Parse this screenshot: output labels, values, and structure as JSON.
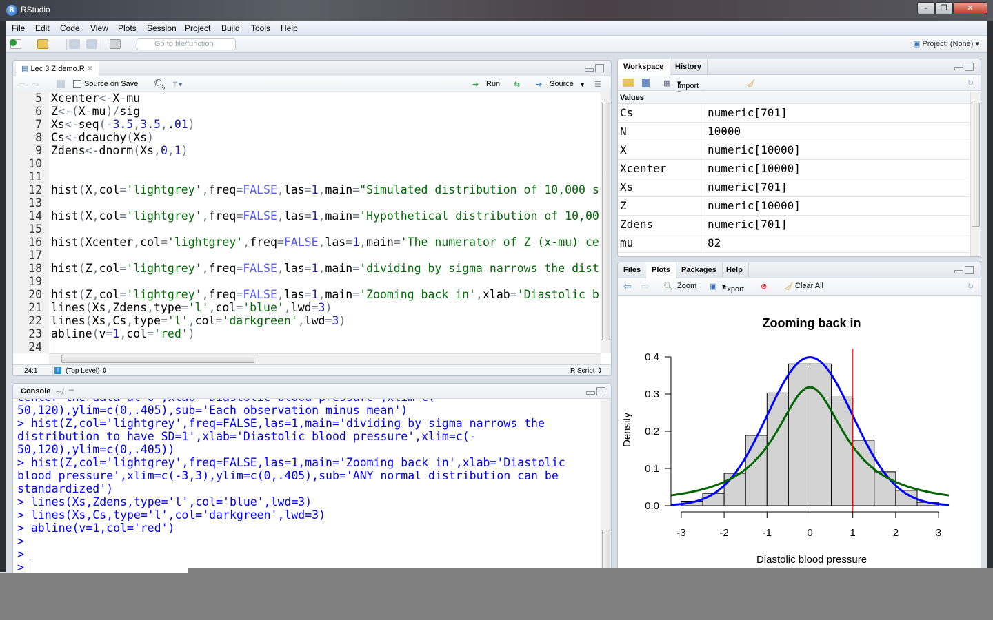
{
  "window": {
    "title": "RStudio"
  },
  "menu": [
    "File",
    "Edit",
    "Code",
    "View",
    "Plots",
    "Session",
    "Project",
    "Build",
    "Tools",
    "Help"
  ],
  "toolbar": {
    "goto_placeholder": "Go to file/function",
    "project": "Project: (None)"
  },
  "editor": {
    "tab": "Lec 3 Z demo.R",
    "source_on_save": "Source on Save",
    "run": "Run",
    "source": "Source",
    "first_line_number": 5,
    "lines": [
      "Xcenter<-X-mu",
      "Z<-(X-mu)/sig",
      "Xs<-seq(-3.5,3.5,.01)",
      "Cs<-dcauchy(Xs)",
      "Zdens<-dnorm(Xs,0,1)",
      "",
      "",
      "hist(X,col='lightgrey',freq=FALSE,las=1,main=\"Simulated distribution of 10,000 s",
      "",
      "hist(X,col='lightgrey',freq=FALSE,las=1,main='Hypothetical distribution of 10,00",
      "",
      "hist(Xcenter,col='lightgrey',freq=FALSE,las=1,main='The numerator of Z (x-mu) ce",
      "",
      "hist(Z,col='lightgrey',freq=FALSE,las=1,main='dividing by sigma narrows the dist",
      "",
      "hist(Z,col='lightgrey',freq=FALSE,las=1,main='Zooming back in',xlab='Diastolic b",
      "lines(Xs,Zdens,type='l',col='blue',lwd=3)",
      "lines(Xs,Cs,type='l',col='darkgreen',lwd=3)",
      "abline(v=1,col='red')",
      ""
    ],
    "cursor_pos": "24:1",
    "scope": "(Top Level)",
    "file_type": "R Script"
  },
  "console": {
    "title": "Console",
    "path": "~/",
    "lines": [
      "center the data at 0',xlab='Diastolic blood pressure',xlim=c(",
      "50,120),ylim=c(0,.405),sub='Each observation minus mean')",
      "> hist(Z,col='lightgrey',freq=FALSE,las=1,main='dividing by sigma narrows the",
      "distribution to have SD=1',xlab='Diastolic blood pressure',xlim=c(-",
      "50,120),ylim=c(0,.405))",
      "> hist(Z,col='lightgrey',freq=FALSE,las=1,main='Zooming back in',xlab='Diastolic",
      "blood pressure',xlim=c(-3,3),ylim=c(0,.405),sub='ANY normal distribution can be",
      "standardized')",
      "> lines(Xs,Zdens,type='l',col='blue',lwd=3)",
      "> lines(Xs,Cs,type='l',col='darkgreen',lwd=3)",
      "> abline(v=1,col='red')",
      ">",
      ">",
      ">"
    ]
  },
  "workspace": {
    "tabs": [
      "Workspace",
      "History"
    ],
    "import": "Import Dataset",
    "section": "Values",
    "rows": [
      {
        "name": "Cs",
        "value": "numeric[701]"
      },
      {
        "name": "N",
        "value": "10000"
      },
      {
        "name": "X",
        "value": "numeric[10000]"
      },
      {
        "name": "Xcenter",
        "value": "numeric[10000]"
      },
      {
        "name": "Xs",
        "value": "numeric[701]"
      },
      {
        "name": "Z",
        "value": "numeric[10000]"
      },
      {
        "name": "Zdens",
        "value": "numeric[701]"
      },
      {
        "name": "mu",
        "value": "82"
      }
    ]
  },
  "plots": {
    "tabs": [
      "Files",
      "Plots",
      "Packages",
      "Help"
    ],
    "zoom": "Zoom",
    "export": "Export",
    "clear_all": "Clear All"
  },
  "chart_data": {
    "type": "bar",
    "title": "Zooming back in",
    "xlabel": "Diastolic blood pressure",
    "ylabel": "Density",
    "subtitle": "ANY normal distribution can be standardized",
    "xlim": [
      -3,
      3
    ],
    "ylim": [
      0,
      0.405
    ],
    "xticks": [
      "-3",
      "-2",
      "-1",
      "0",
      "1",
      "2",
      "3"
    ],
    "yticks": [
      "0.0",
      "0.1",
      "0.2",
      "0.3",
      "0.4"
    ],
    "bin_edges": [
      -3,
      -2.5,
      -2,
      -1.5,
      -1,
      -0.5,
      0,
      0.5,
      1,
      1.5,
      2,
      2.5,
      3
    ],
    "values": [
      0.012,
      0.033,
      0.087,
      0.189,
      0.303,
      0.381,
      0.381,
      0.292,
      0.176,
      0.091,
      0.041,
      0.009
    ],
    "bar_color": "#d3d3d3",
    "curves": [
      {
        "function": "dnorm",
        "mean": 0,
        "sd": 1,
        "color": "#0000ff",
        "x_from": -3.5,
        "x_to": 3.5,
        "step": 0.01
      },
      {
        "function": "dcauchy",
        "location": 0,
        "scale": 1,
        "color": "#006400",
        "x_from": -3.5,
        "x_to": 3.5,
        "step": 0.01
      }
    ],
    "vline": {
      "x": 1,
      "color": "#ff0000"
    },
    "grid": false
  }
}
